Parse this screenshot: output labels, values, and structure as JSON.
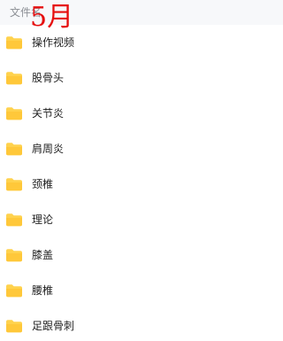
{
  "header": {
    "column_label": "文件名"
  },
  "overlay": {
    "text": "5月",
    "color": "#e60f0f"
  },
  "folder_icon": {
    "name": "folder-icon",
    "color": "#ffd24d"
  },
  "files": [
    {
      "name": "操作视频"
    },
    {
      "name": "股骨头"
    },
    {
      "name": "关节炎"
    },
    {
      "name": "肩周炎"
    },
    {
      "name": "颈椎"
    },
    {
      "name": "理论"
    },
    {
      "name": "膝盖"
    },
    {
      "name": "腰椎"
    },
    {
      "name": "足跟骨刺"
    }
  ]
}
